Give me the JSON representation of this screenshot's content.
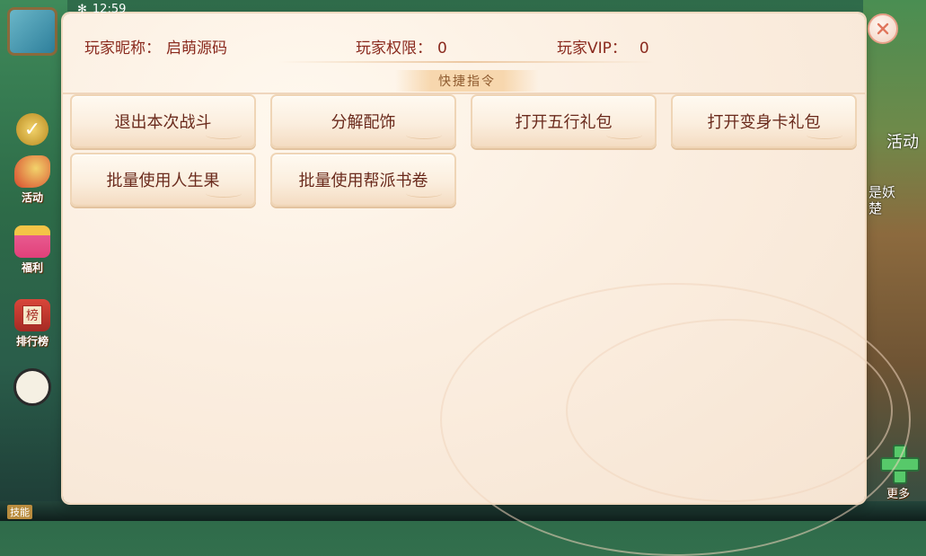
{
  "status_bar": {
    "time": "12:59"
  },
  "side_menu": [
    {
      "key": "activity",
      "label": "活动"
    },
    {
      "key": "welfare",
      "label": "福利"
    },
    {
      "key": "ranking",
      "label": "排行榜",
      "badge": "榜"
    }
  ],
  "right_side": {
    "activity_tab": "活动",
    "quest_text": "是妖\n楚",
    "more_label": "更多"
  },
  "bottom_left": "技能",
  "dialog": {
    "player_name_label": "玩家昵称：",
    "player_name_value": "启萌源码",
    "permission_label": "玩家权限：",
    "permission_value": "0",
    "vip_label": "玩家VIP：",
    "vip_value": "0",
    "section_title": "快捷指令",
    "commands": [
      "退出本次战斗",
      "分解配饰",
      "打开五行礼包",
      "打开变身卡礼包",
      "批量使用人生果",
      "批量使用帮派书卷"
    ]
  },
  "colors": {
    "accent_text": "#8a2a1e",
    "button_text": "#6a2a1c",
    "close_x": "#e0765c"
  }
}
